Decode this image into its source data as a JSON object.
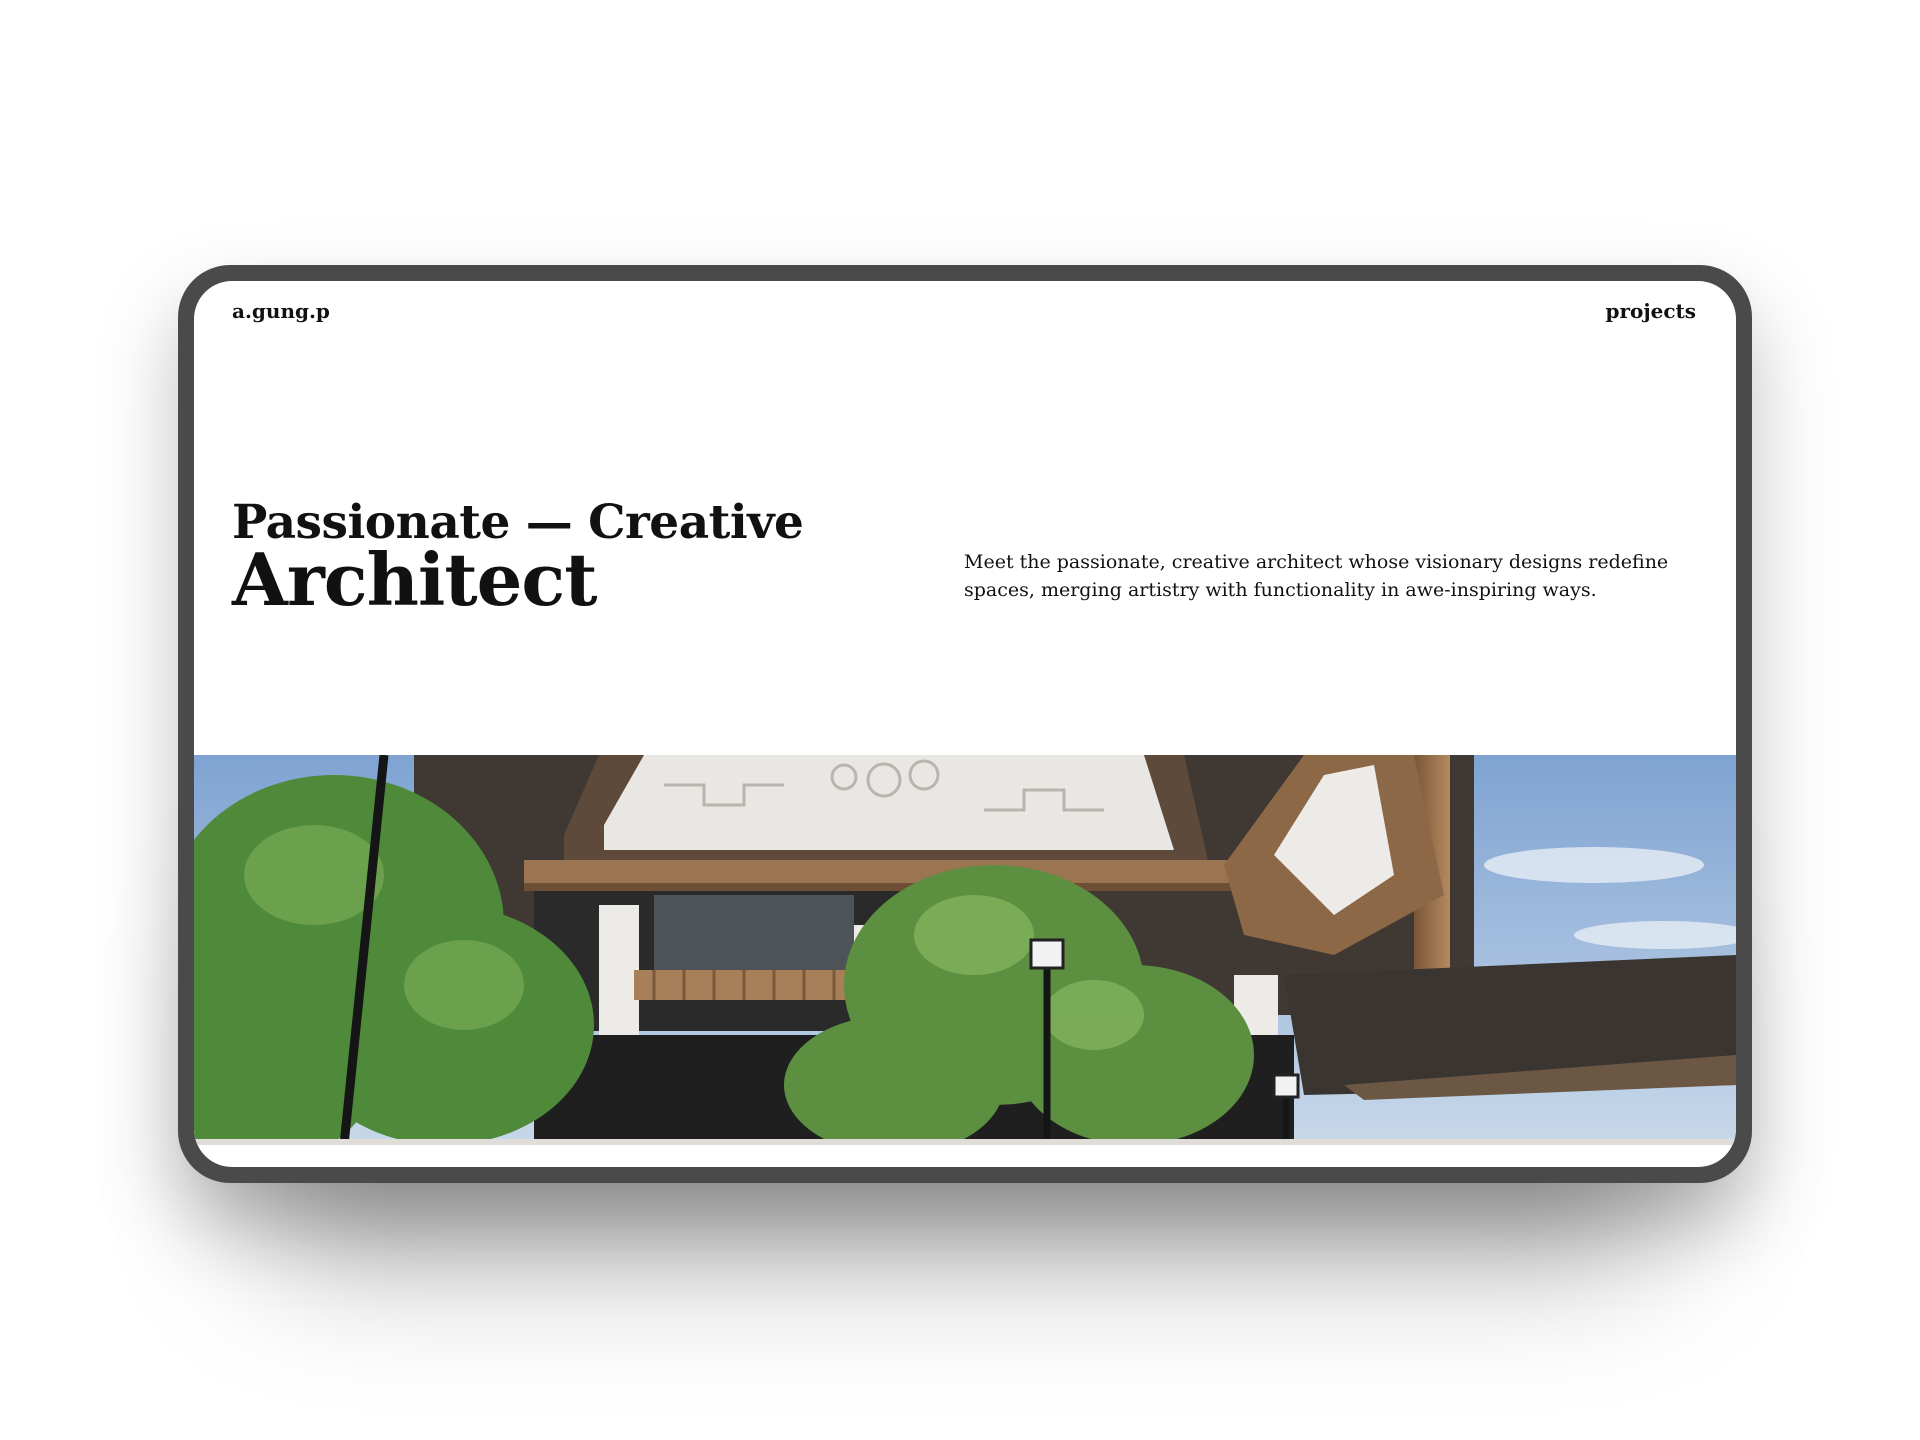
{
  "nav": {
    "brand": "a.gung.p",
    "projects_label": "projects"
  },
  "hero": {
    "headline_line1": "Passionate — Creative",
    "headline_line2": "Architect",
    "intro": "Meet the passionate, creative architect whose visionary designs redefine spaces, merging artistry with functionality in awe-inspiring ways."
  },
  "image": {
    "subject": "rendered traditional timber building with carved gables, trees and street lamps"
  },
  "colors": {
    "device_frame": "#4a4a4a",
    "text": "#111111",
    "sky": "#8fb0d8",
    "roof": "#4b433d",
    "wood": "#9a6f48",
    "foliage": "#4f8a3a"
  }
}
